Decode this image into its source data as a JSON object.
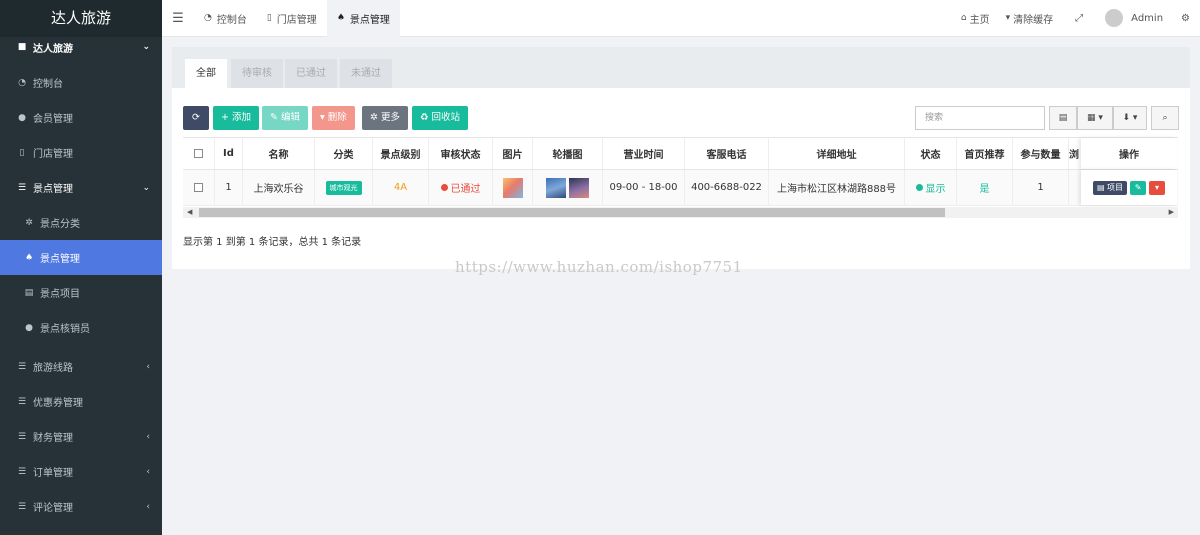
{
  "sidebar": {
    "brand": "达人旅游",
    "group_title": "达人旅游",
    "items": [
      {
        "label": "控制台"
      },
      {
        "label": "会员管理"
      },
      {
        "label": "门店管理"
      },
      {
        "label": "景点管理"
      },
      {
        "label": "景点分类"
      },
      {
        "label": "景点管理"
      },
      {
        "label": "景点项目"
      },
      {
        "label": "景点核销员"
      },
      {
        "label": "旅游线路"
      },
      {
        "label": "优惠券管理"
      },
      {
        "label": "财务管理"
      },
      {
        "label": "订单管理"
      },
      {
        "label": "评论管理"
      }
    ]
  },
  "topbar": {
    "tabs": [
      {
        "label": "控制台"
      },
      {
        "label": "门店管理"
      },
      {
        "label": "景点管理"
      }
    ],
    "home": "主页",
    "clear_cache": "清除缓存",
    "user": "Admin"
  },
  "panel": {
    "tabs": [
      "全部",
      "待审核",
      "已通过",
      "未通过"
    ],
    "toolbar": {
      "add": "添加",
      "edit": "编辑",
      "delete": "删除",
      "more": "更多",
      "recycle": "回收站",
      "search_placeholder": "搜索"
    },
    "columns": [
      "Id",
      "名称",
      "分类",
      "景点级别",
      "审核状态",
      "图片",
      "轮播图",
      "营业时间",
      "客服电话",
      "详细地址",
      "状态",
      "首页推荐",
      "参与数量",
      "浏",
      "操作"
    ],
    "rows": [
      {
        "id": "1",
        "name": "上海欢乐谷",
        "category": "城市观光",
        "level": "4A",
        "audit": "已通过",
        "hours": "09-00 - 18-00",
        "phone": "400-6688-022",
        "address": "上海市松江区林湖路888号",
        "status": "显示",
        "recommend": "是",
        "count": "1",
        "op_project": "项目"
      }
    ],
    "summary": "显示第 1 到第 1 条记录，总共 1 条记录"
  },
  "watermark": "https://www.huzhan.com/ishop7751",
  "colors": {
    "sidebar_bg": "#263238",
    "active": "#4f78e0",
    "green": "#18bc9c",
    "red": "#e74c3c",
    "dark_btn": "#3e4a66"
  }
}
